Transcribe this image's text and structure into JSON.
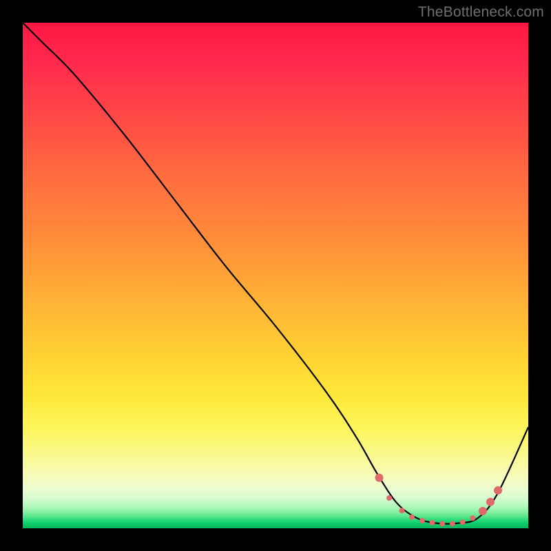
{
  "watermark": "TheBottleneck.com",
  "chart_data": {
    "type": "line",
    "title": "",
    "xlabel": "",
    "ylabel": "",
    "xlim": [
      0,
      100
    ],
    "ylim": [
      0,
      100
    ],
    "grid": false,
    "legend": false,
    "series": [
      {
        "name": "bottleneck-curve",
        "color": "#000000",
        "x": [
          0,
          4,
          10,
          20,
          30,
          40,
          50,
          60,
          66,
          70,
          74,
          78,
          82,
          86,
          90,
          94,
          100
        ],
        "y": [
          100,
          96,
          90,
          78,
          65,
          52,
          40,
          27,
          18,
          11,
          5,
          2,
          1,
          1,
          2,
          7,
          20
        ]
      }
    ],
    "markers": {
      "name": "optimal-range",
      "color": "#e06a6a",
      "radius_small": 4,
      "radius_large": 6,
      "points": [
        {
          "x": 70.5,
          "y": 10,
          "r": "large"
        },
        {
          "x": 72.5,
          "y": 6,
          "r": "small"
        },
        {
          "x": 75,
          "y": 3.5,
          "r": "small"
        },
        {
          "x": 77,
          "y": 2.2,
          "r": "small"
        },
        {
          "x": 79,
          "y": 1.5,
          "r": "small"
        },
        {
          "x": 81,
          "y": 1.1,
          "r": "small"
        },
        {
          "x": 83,
          "y": 0.9,
          "r": "small"
        },
        {
          "x": 85,
          "y": 0.9,
          "r": "small"
        },
        {
          "x": 87,
          "y": 1.2,
          "r": "small"
        },
        {
          "x": 89,
          "y": 2.0,
          "r": "small"
        },
        {
          "x": 91,
          "y": 3.4,
          "r": "large"
        },
        {
          "x": 92.5,
          "y": 5.2,
          "r": "large"
        },
        {
          "x": 94,
          "y": 7.5,
          "r": "large"
        }
      ]
    }
  }
}
